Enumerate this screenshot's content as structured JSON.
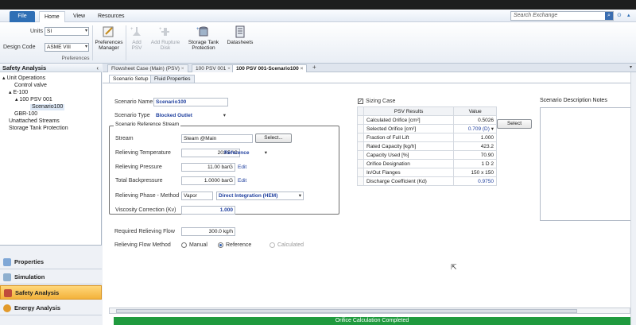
{
  "menu": {
    "file": "File",
    "home": "Home",
    "view": "View",
    "resources": "Resources",
    "search_placeholder": "Search Exchange"
  },
  "ribbon": {
    "units_label": "Units",
    "units_value": "SI",
    "design_code_label": "Design Code",
    "design_code_value": "ASME VIII",
    "preferences_group": "Preferences",
    "preferences_manager": "Preferences Manager",
    "add_psv": "Add PSV",
    "add_rupture_disk": "Add Rupture Disk",
    "storage_tank_protection": "Storage Tank Protection",
    "datasheets": "Datasheets"
  },
  "nav": {
    "title": "Safety Analysis",
    "tree": [
      "Unit Operations",
      "Control valve",
      "E-100",
      "100 PSV 001",
      "Scenario100",
      "GBR-100",
      "Unattached Streams",
      "Storage Tank Protection"
    ],
    "buttons": [
      "Properties",
      "Simulation",
      "Safety Analysis",
      "Energy Analysis"
    ]
  },
  "doc_tabs": [
    "Flowsheet Case (Main) (PSV)",
    "100 PSV 001",
    "100 PSV 001-Scenario100"
  ],
  "sub_tabs": [
    "Scenario Setup",
    "Fluid Properties"
  ],
  "form": {
    "scenario_name_label": "Scenario Name",
    "scenario_name": "Scenario100",
    "scenario_type_label": "Scenario Type",
    "scenario_type": "Blocked Outlet",
    "ref_stream_group": "Scenario Reference Stream",
    "stream_label": "Stream",
    "stream_value": "Steam @Main",
    "select_btn": "Select...",
    "reliev_temp_label": "Relieving Temperature",
    "reliev_temp": "203.5 °C",
    "reliev_temp_mode": "Reference",
    "reliev_press_label": "Relieving Pressure",
    "reliev_press": "11.00 barG",
    "edit1": "Edit",
    "back_press_label": "Total Backpressure",
    "back_press": "1.0000 barG",
    "edit2": "Edit",
    "phase_label": "Relieving Phase - Method",
    "phase": "Vapor",
    "method": "Direct Integration (HEM)",
    "visc_label": "Viscosity Correction  (Kv)",
    "visc": "1.000",
    "req_flow_label": "Required Relieving Flow",
    "req_flow": "300.0 kg/h",
    "flow_method_label": "Relieving Flow Method",
    "opt_manual": "Manual",
    "opt_reference": "Reference",
    "opt_calculated": "Calculated"
  },
  "sizing": {
    "checkbox_label": "Sizing Case",
    "col1": "PSV Results",
    "col2": "Value",
    "rows": [
      {
        "label": "Calculated Orifice [cm²]",
        "value": "0.5026"
      },
      {
        "label": "Selected Orifice [cm²]",
        "value": "0.709 (D)"
      },
      {
        "label": "Fraction of Full Lift",
        "value": "1.000"
      },
      {
        "label": "Rated Capacity [kg/h]",
        "value": "423.2"
      },
      {
        "label": "Capacity Used [%]",
        "value": "70.90"
      },
      {
        "label": "Orifice Designation",
        "value": "1 D 2"
      },
      {
        "label": "In/Out Flanges",
        "value": "150 x 150"
      },
      {
        "label": "Discharge Coefficient (Kd)",
        "value": "0.9750"
      }
    ],
    "select_btn": "Select"
  },
  "notes_label": "Scenario Description Notes",
  "status": "Orifice Calculation Completed",
  "colors": {
    "accent": "#1f3f9e",
    "status": "#1f9a3e",
    "file_tab": "#2f6fb5"
  }
}
